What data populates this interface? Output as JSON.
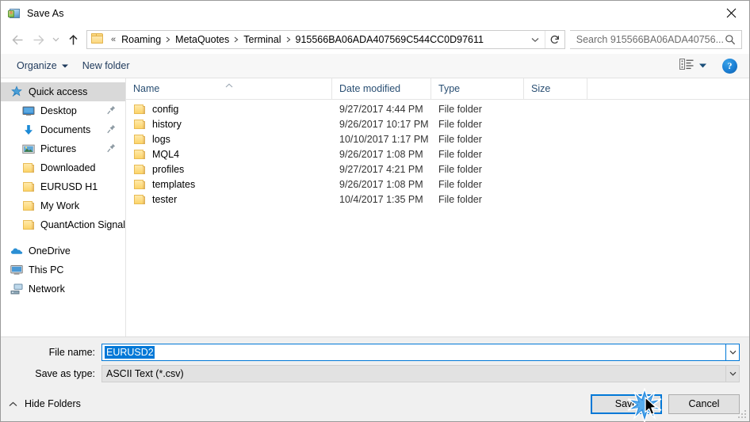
{
  "window": {
    "title": "Save As",
    "icon": "app-icon",
    "close_label": "✕"
  },
  "nav": {
    "back_icon": "back-arrow-icon",
    "forward_icon": "forward-arrow-icon",
    "recent_icon": "chevron-down-icon",
    "up_icon": "up-arrow-icon",
    "breadcrumb_prefix": "«",
    "breadcrumbs": [
      "Roaming",
      "MetaQuotes",
      "Terminal",
      "915566BA06ADA407569C544CC0D97611"
    ],
    "breadcrumb_dropdown_icon": "chevron-down-icon",
    "refresh_icon": "refresh-icon"
  },
  "search": {
    "placeholder": "Search 915566BA06ADA40756...",
    "icon": "search-icon"
  },
  "toolbar": {
    "organize_label": "Organize",
    "organize_caret": "caret-down-icon",
    "new_folder_label": "New folder",
    "view_icon": "view-layout-icon",
    "view_caret": "caret-down-icon",
    "help_label": "?",
    "help_icon": "help-icon"
  },
  "sidebar": {
    "items": [
      {
        "label": "Quick access",
        "icon": "star-pin-icon",
        "selected": true,
        "indent": false,
        "pinned": false
      },
      {
        "label": "Desktop",
        "icon": "desktop-icon",
        "selected": false,
        "indent": true,
        "pinned": true
      },
      {
        "label": "Documents",
        "icon": "documents-download-icon",
        "selected": false,
        "indent": true,
        "pinned": true
      },
      {
        "label": "Pictures",
        "icon": "pictures-icon",
        "selected": false,
        "indent": true,
        "pinned": true
      },
      {
        "label": "Downloaded",
        "icon": "folder-icon",
        "selected": false,
        "indent": true,
        "pinned": false
      },
      {
        "label": "EURUSD H1",
        "icon": "folder-icon",
        "selected": false,
        "indent": true,
        "pinned": false
      },
      {
        "label": "My Work",
        "icon": "folder-icon",
        "selected": false,
        "indent": true,
        "pinned": false
      },
      {
        "label": "QuantAction Signal",
        "icon": "folder-icon",
        "selected": false,
        "indent": true,
        "pinned": false
      }
    ],
    "groups": [
      {
        "label": "OneDrive",
        "icon": "onedrive-cloud-icon"
      },
      {
        "label": "This PC",
        "icon": "this-pc-icon"
      },
      {
        "label": "Network",
        "icon": "network-icon"
      }
    ]
  },
  "filelist": {
    "columns": [
      "Name",
      "Date modified",
      "Type",
      "Size"
    ],
    "sort_column": "Name",
    "sort_direction": "ascending",
    "rows": [
      {
        "name": "config",
        "date": "9/27/2017 4:44 PM",
        "type": "File folder",
        "size": ""
      },
      {
        "name": "history",
        "date": "9/26/2017 10:17 PM",
        "type": "File folder",
        "size": ""
      },
      {
        "name": "logs",
        "date": "10/10/2017 1:17 PM",
        "type": "File folder",
        "size": ""
      },
      {
        "name": "MQL4",
        "date": "9/26/2017 1:08 PM",
        "type": "File folder",
        "size": ""
      },
      {
        "name": "profiles",
        "date": "9/27/2017 4:21 PM",
        "type": "File folder",
        "size": ""
      },
      {
        "name": "templates",
        "date": "9/26/2017 1:08 PM",
        "type": "File folder",
        "size": ""
      },
      {
        "name": "tester",
        "date": "10/4/2017 1:35 PM",
        "type": "File folder",
        "size": ""
      }
    ]
  },
  "form": {
    "filename_label": "File name:",
    "filename_value": "EURUSD2",
    "filetype_label": "Save as type:",
    "filetype_value": "ASCII Text (*.csv)",
    "dropdown_icon": "chevron-down-icon"
  },
  "footer": {
    "hide_folders_label": "Hide Folders",
    "hide_folders_caret": "caret-up-icon",
    "save_label": "Save",
    "cancel_label": "Cancel",
    "resize_grip": "resize-grip-icon",
    "click_indicator": "click-burst-icon",
    "cursor": "mouse-pointer-icon"
  },
  "colors": {
    "accent": "#0078d7",
    "selection": "#0078d7",
    "sidebar_selected": "#d9d9d9",
    "header_text": "#2a4f73",
    "command_text": "#1e395b",
    "folder_yellow": "#fcd469",
    "dialog_bg": "#f0f0f0"
  }
}
